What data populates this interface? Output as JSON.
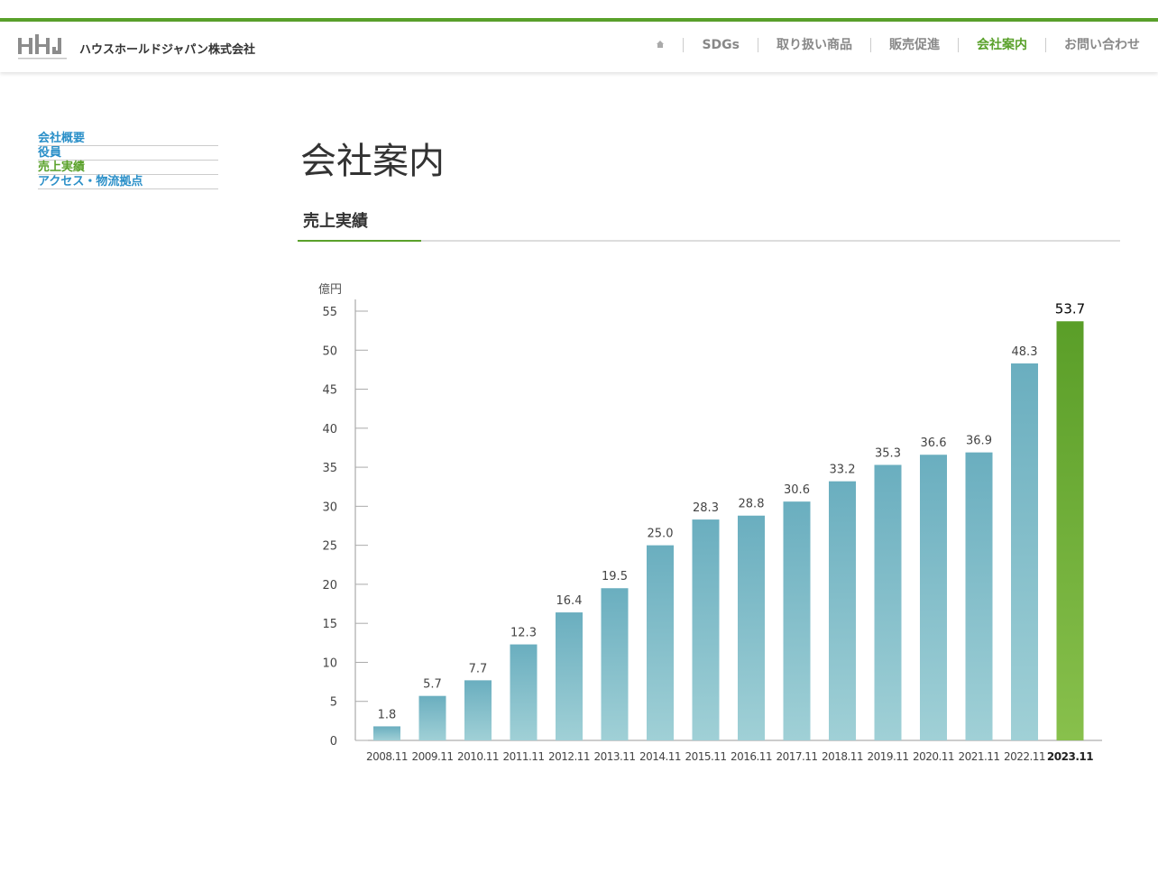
{
  "header": {
    "company_name": "ハウスホールドジャパン株式会社",
    "nav": [
      {
        "label": "SDGs",
        "active": false
      },
      {
        "label": "取り扱い商品",
        "active": false
      },
      {
        "label": "販売促進",
        "active": false
      },
      {
        "label": "会社案内",
        "active": true
      },
      {
        "label": "お問い合わせ",
        "active": false
      }
    ]
  },
  "sidebar": {
    "items": [
      {
        "label": "会社概要",
        "active": false
      },
      {
        "label": "役員",
        "active": false
      },
      {
        "label": "売上実績",
        "active": true
      },
      {
        "label": "アクセス・物流拠点",
        "active": false
      }
    ]
  },
  "main": {
    "page_title": "会社案内",
    "section_title": "売上実績"
  },
  "colors": {
    "accent_green": "#5aa12b",
    "link_blue": "#2a8fc8",
    "bar_blue_top": "#6aaebf",
    "bar_blue_bottom": "#a0d0d6",
    "bar_green_top": "#5a9e28",
    "bar_green_bottom": "#88c04c"
  },
  "chart_data": {
    "type": "bar",
    "ylabel": "億円",
    "ylim": [
      0,
      55
    ],
    "yticks": [
      0,
      5,
      10,
      15,
      20,
      25,
      30,
      35,
      40,
      45,
      50,
      55
    ],
    "categories": [
      "2008.11",
      "2009.11",
      "2010.11",
      "2011.11",
      "2012.11",
      "2013.11",
      "2014.11",
      "2015.11",
      "2016.11",
      "2017.11",
      "2018.11",
      "2019.11",
      "2020.11",
      "2021.11",
      "2022.11",
      "2023.11"
    ],
    "values": [
      1.8,
      5.7,
      7.7,
      12.3,
      16.4,
      19.5,
      25.0,
      28.3,
      28.8,
      30.6,
      33.2,
      35.3,
      36.6,
      36.9,
      48.3,
      53.7
    ],
    "value_labels": [
      "1.8",
      "5.7",
      "7.7",
      "12.3",
      "16.4",
      "19.5",
      "25.0",
      "28.3",
      "28.8",
      "30.6",
      "33.2",
      "35.3",
      "36.6",
      "36.9",
      "48.3",
      "53.7"
    ],
    "highlight_index": 15,
    "grid": false,
    "legend": "none"
  }
}
